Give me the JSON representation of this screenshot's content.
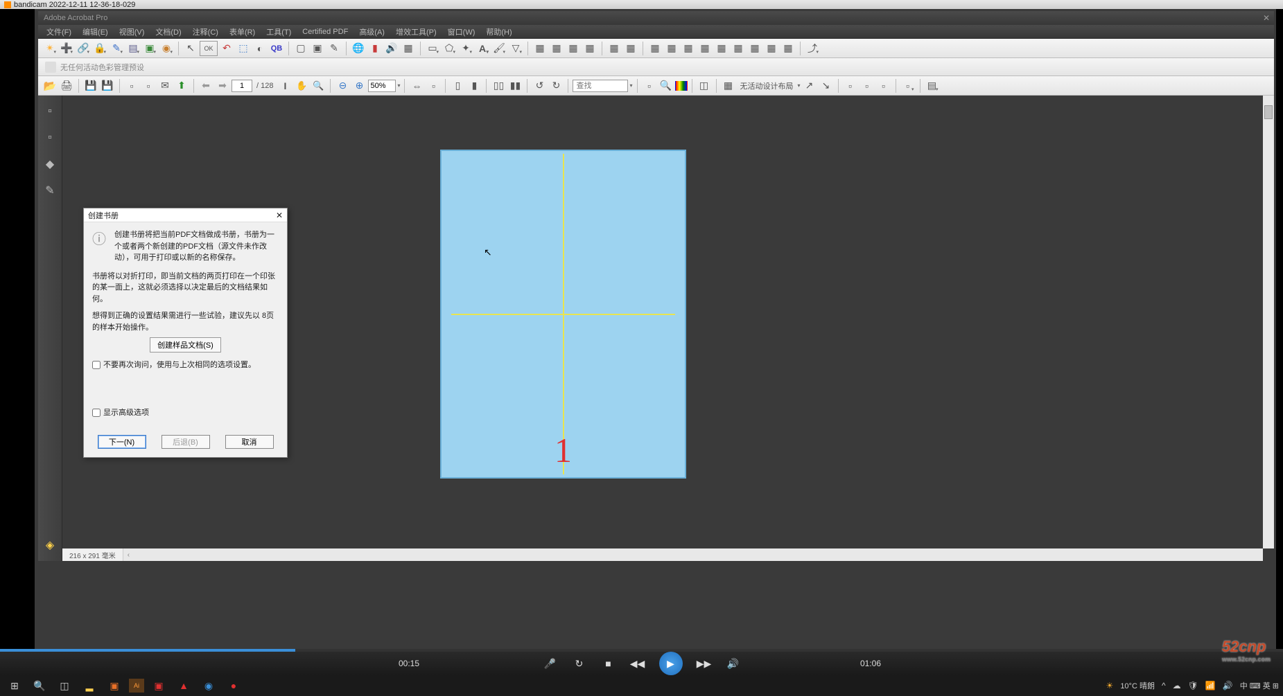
{
  "bandicam": {
    "title": "bandicam 2022-12-11 12-36-18-029"
  },
  "acrobat_title": "Adobe Acrobat Pro",
  "menu": {
    "file": "文件(F)",
    "edit": "编辑(E)",
    "view": "视图(V)",
    "document": "文档(D)",
    "comment": "注释(C)",
    "forms": "表单(R)",
    "tools": "工具(T)",
    "certified": "Certified PDF",
    "advanced": "高级(A)",
    "pitstop": "增效工具(P)",
    "window": "窗口(W)",
    "help": "帮助(H)"
  },
  "toolbar1": {
    "arrow": "▸",
    "ok_btn": "OK",
    "qb": "QB"
  },
  "color_mgmt": "无任何活动色彩管理预设",
  "toolbar2": {
    "page_current": "1",
    "page_total": "/ 128",
    "zoom": "50%",
    "search_placeholder": "查找",
    "layout_label": "无活动设计布局"
  },
  "page_preview": {
    "number": "1"
  },
  "dialog": {
    "title": "创建书册",
    "desc1": "创建书册将把当前PDF文档做成书册，书册为一个或者两个新创建的PDF文档（源文件未作改动），可用于打印或以新的名称保存。",
    "desc2": "书册将以对折打印，即当前文档的两页打印在一个印张的某一面上，这就必须选择以决定最后的文档结果如何。",
    "desc3": "想得到正确的设置结果需进行一些试验，建议先以 8页的样本开始操作。",
    "sample_btn": "创建样品文档(S)",
    "dont_ask": "不要再次询问，使用与上次相同的选项设置。",
    "show_advanced": "显示高级选项",
    "next": "下一(N)",
    "back": "后退(B)",
    "cancel": "取消"
  },
  "statusbar": {
    "dims": "216 x 291 毫米"
  },
  "player": {
    "current": "00:15",
    "total": "01:06"
  },
  "tray": {
    "weather": "10°C 晴朗",
    "ime": "中 ⌨ 英 ⊞"
  },
  "watermark": {
    "main": "52cnp",
    "sub": "www.52cnp.com"
  }
}
